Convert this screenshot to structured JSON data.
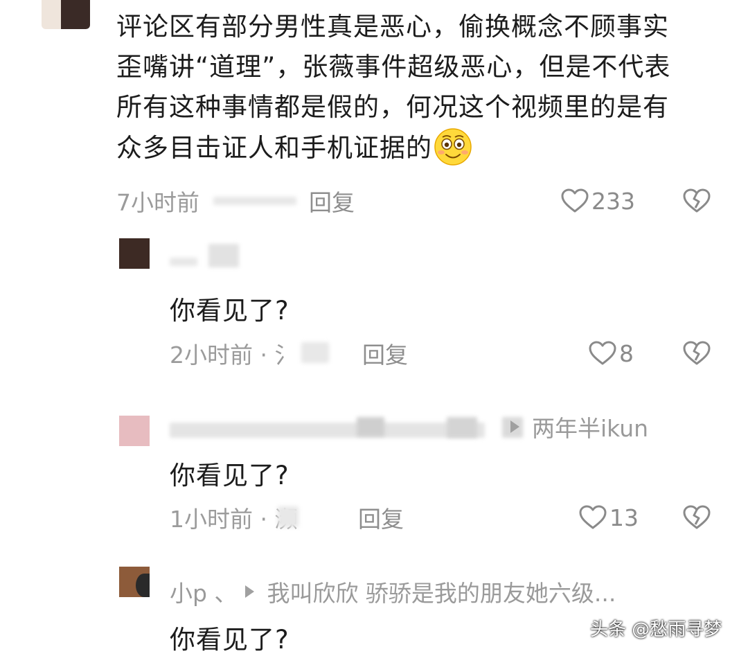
{
  "main_comment": {
    "text_lines": [
      "评论区有部分男性真是恶心，偷换概念不顾事实",
      "歪嘴讲“道理”，张薇事件超级恶心，但是不代表",
      "所有这种事情都是假的，何况这个视频里的是有",
      "众多目击证人和手机证据的"
    ],
    "emoji": "smiling-face-icon",
    "time": "7小时前",
    "reply_label": "回复",
    "likes": "233"
  },
  "replies": [
    {
      "name": "",
      "reply_to": "",
      "text": "你看见了?",
      "time": "2小时前 · 氵",
      "reply_label": "回复",
      "likes": "8"
    },
    {
      "name": "",
      "reply_to": "两年半ikun",
      "text": "你看见了?",
      "time": "1小时前 · 濒",
      "reply_label": "回复",
      "likes": "13"
    },
    {
      "name": "小p 、",
      "reply_to": "我叫欣欣 骄骄是我的朋友她六级...",
      "text": "你看见了?",
      "time": "",
      "reply_label": "",
      "likes": ""
    }
  ],
  "watermark": "头条 @愁雨寻梦",
  "colors": {
    "text": "#1c1c1c",
    "meta": "#9b9b9b",
    "icon": "#8a8a8a"
  }
}
